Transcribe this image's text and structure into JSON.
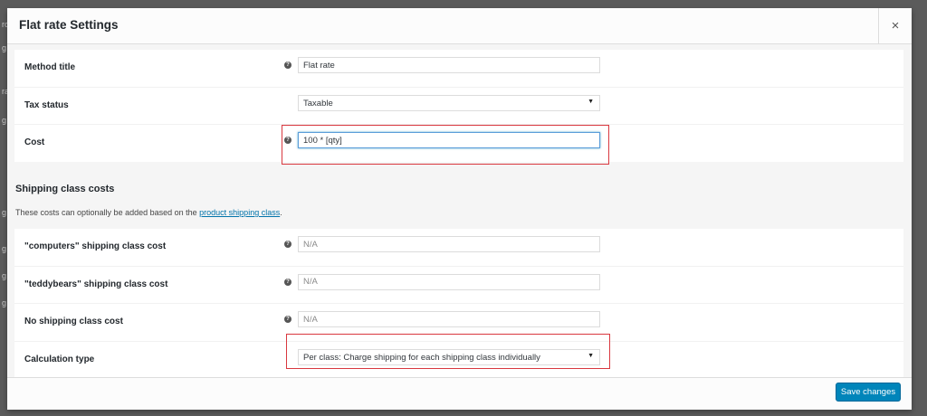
{
  "backdrop": {
    "fragments": [
      "ro",
      "g",
      "ra",
      "g",
      "g",
      "g",
      "g",
      "g"
    ]
  },
  "modal": {
    "title": "Flat rate Settings",
    "close_glyph": "×",
    "help_glyph": "?",
    "fields": {
      "method_title": {
        "label": "Method title",
        "value": "Flat rate"
      },
      "tax_status": {
        "label": "Tax status",
        "selected": "Taxable"
      },
      "cost": {
        "label": "Cost",
        "value": "100 * [qty]"
      }
    },
    "shipping_class_section": {
      "title": "Shipping class costs",
      "description_prefix": "These costs can optionally be added based on the ",
      "description_link": "product shipping class",
      "description_suffix": "."
    },
    "class_fields": {
      "computers": {
        "label": "\"computers\" shipping class cost",
        "placeholder": "N/A"
      },
      "teddybears": {
        "label": "\"teddybears\" shipping class cost",
        "placeholder": "N/A"
      },
      "no_class": {
        "label": "No shipping class cost",
        "placeholder": "N/A"
      },
      "calculation_type": {
        "label": "Calculation type",
        "selected": "Per class: Charge shipping for each shipping class individually"
      }
    },
    "save_label": "Save changes"
  },
  "colors": {
    "highlight": "#d9383f",
    "primary_button": "#0085ba",
    "link": "#0073aa",
    "focus": "#5b9dd9"
  }
}
